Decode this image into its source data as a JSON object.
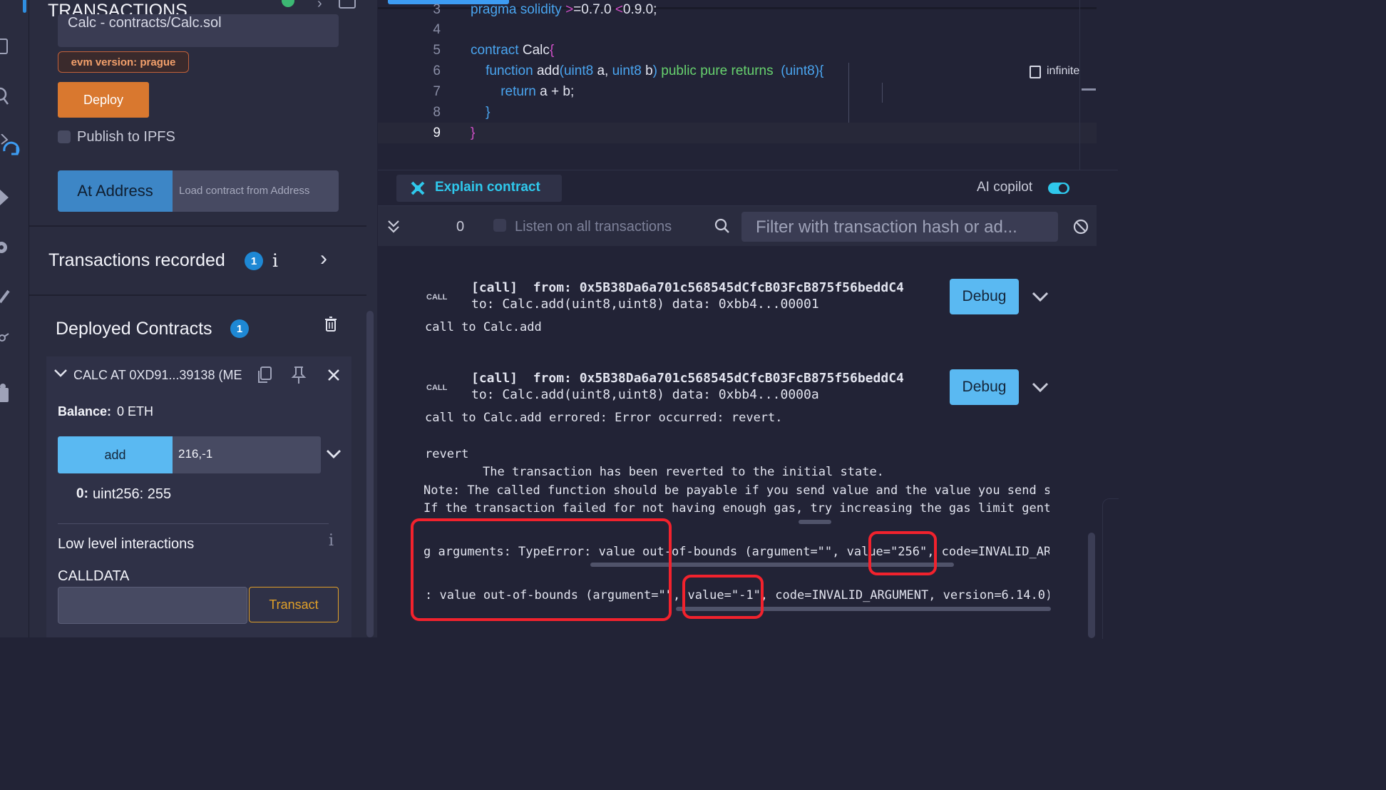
{
  "left": {
    "header": "TRANSACTIONS",
    "contract_field": "Calc - contracts/Calc.sol",
    "evm_tag": "evm version: prague",
    "deploy_label": "Deploy",
    "publish_label": "Publish to IPFS",
    "at_address_label": "At Address",
    "load_placeholder": "Load contract from Address",
    "tx_recorded": {
      "label": "Transactions recorded",
      "count": "1",
      "info": "i"
    },
    "deployed": {
      "label": "Deployed Contracts",
      "count": "1"
    },
    "instance": {
      "title": "CALC AT 0XD91...39138 (ME",
      "balance_label": "Balance:",
      "balance_value": "0 ETH",
      "fn_label": "add",
      "fn_args": "216,-1",
      "output_index": "0:",
      "output_value": "uint256: 255"
    },
    "low_level": {
      "label": "Low level interactions",
      "info": "i",
      "calldata_label": "CALLDATA",
      "transact_label": "Transact"
    }
  },
  "editor": {
    "lines": [
      {
        "n": "3",
        "t": "pragma solidity >=0.7.0 <0.9.0;"
      },
      {
        "n": "4",
        "t": ""
      },
      {
        "n": "5",
        "t": "contract Calc{"
      },
      {
        "n": "6",
        "t": "function add(uint8 a, uint8 b) public pure returns  (uint8){"
      },
      {
        "n": "7",
        "t": "return a + b;"
      },
      {
        "n": "8",
        "t": "}"
      },
      {
        "n": "9",
        "t": "}"
      }
    ],
    "gas_hint": "infinite"
  },
  "toolbar": {
    "explain_label": "Explain contract",
    "ai_copilot_label": "AI copilot",
    "tx_count": "0",
    "listen_label": "Listen on all transactions",
    "filter_placeholder": "Filter with transaction hash or ad..."
  },
  "terminal": {
    "entries": [
      {
        "call_tag": "CALL",
        "line1": "[call]  from: 0x5B38Da6a701c568545dCfcB03FcB875f56beddC4",
        "line2": "to: Calc.add(uint8,uint8) data: 0xbb4...00001",
        "summary": "call to Calc.add",
        "debug": "Debug"
      },
      {
        "call_tag": "CALL",
        "line1": "[call]  from: 0x5B38Da6a701c568545dCfcB03FcB875f56beddC4",
        "line2": "to: Calc.add(uint8,uint8) data: 0xbb4...0000a",
        "summary": "call to Calc.add errored: Error occurred: revert.",
        "debug": "Debug"
      }
    ],
    "revert": "revert",
    "reverted_msg": "The transaction has been reverted to the initial state.",
    "note_msg": "Note: The called function should be payable if you send value and the value you send s",
    "gas_msg": "If the transaction failed for not having enough gas, try increasing the gas limit gent",
    "error1": "g arguments: TypeError: value out-of-bounds (argument=\"\", value=\"256\", code=INVALID_AR(",
    "error2": ": value out-of-bounds (argument=\"\", value=\"-1\", code=INVALID_ARGUMENT, version=6.14.0)"
  }
}
